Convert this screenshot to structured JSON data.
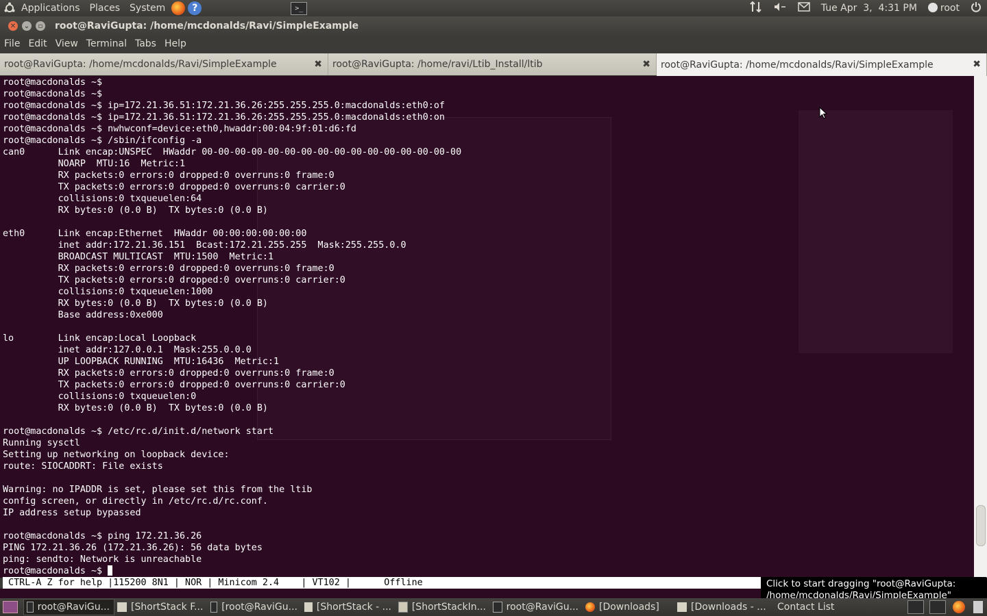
{
  "panel": {
    "applications": "Applications",
    "places": "Places",
    "system": "System",
    "help_glyph": "?",
    "datetime": "Tue Apr  3,  4:31 PM",
    "user": "root"
  },
  "window": {
    "title": "root@RaviGupta: /home/mcdonalds/Ravi/SimpleExample"
  },
  "menu": [
    "File",
    "Edit",
    "View",
    "Terminal",
    "Tabs",
    "Help"
  ],
  "tabs": [
    {
      "label": "root@RaviGupta: /home/mcdonalds/Ravi/SimpleExample"
    },
    {
      "label": "root@RaviGupta: /home/ravi/Ltib_Install/ltib"
    },
    {
      "label": "root@RaviGupta: /home/mcdonalds/Ravi/SimpleExample"
    }
  ],
  "tab_close_glyph": "✖",
  "terminal": {
    "lines": [
      "root@macdonalds ~$",
      "root@macdonalds ~$",
      "root@macdonalds ~$ ip=172.21.36.51:172.21.36.26:255.255.255.0:macdonalds:eth0:of",
      "root@macdonalds ~$ ip=172.21.36.51:172.21.36.26:255.255.255.0:macdonalds:eth0:on",
      "root@macdonalds ~$ nwhwconf=device:eth0,hwaddr:00:04:9f:01:d6:fd",
      "root@macdonalds ~$ /sbin/ifconfig -a",
      "can0      Link encap:UNSPEC  HWaddr 00-00-00-00-00-00-00-00-00-00-00-00-00-00-00-00",
      "          NOARP  MTU:16  Metric:1",
      "          RX packets:0 errors:0 dropped:0 overruns:0 frame:0",
      "          TX packets:0 errors:0 dropped:0 overruns:0 carrier:0",
      "          collisions:0 txqueuelen:64",
      "          RX bytes:0 (0.0 B)  TX bytes:0 (0.0 B)",
      "",
      "eth0      Link encap:Ethernet  HWaddr 00:00:00:00:00:00",
      "          inet addr:172.21.36.151  Bcast:172.21.255.255  Mask:255.255.0.0",
      "          BROADCAST MULTICAST  MTU:1500  Metric:1",
      "          RX packets:0 errors:0 dropped:0 overruns:0 frame:0",
      "          TX packets:0 errors:0 dropped:0 overruns:0 carrier:0",
      "          collisions:0 txqueuelen:1000",
      "          RX bytes:0 (0.0 B)  TX bytes:0 (0.0 B)",
      "          Base address:0xe000",
      "",
      "lo        Link encap:Local Loopback",
      "          inet addr:127.0.0.1  Mask:255.0.0.0",
      "          UP LOOPBACK RUNNING  MTU:16436  Metric:1",
      "          RX packets:0 errors:0 dropped:0 overruns:0 frame:0",
      "          TX packets:0 errors:0 dropped:0 overruns:0 carrier:0",
      "          collisions:0 txqueuelen:0",
      "          RX bytes:0 (0.0 B)  TX bytes:0 (0.0 B)",
      "",
      "root@macdonalds ~$ /etc/rc.d/init.d/network start",
      "Running sysctl",
      "Setting up networking on loopback device:",
      "route: SIOCADDRT: File exists",
      "",
      "Warning: no IPADDR is set, please set this from the ltib",
      "config screen, or directly in /etc/rc.d/rc.conf.",
      "IP address setup bypassed",
      "",
      "root@macdonalds ~$ ping 172.21.36.26",
      "PING 172.21.36.26 (172.21.36.26): 56 data bytes",
      "ping: sendto: Network is unreachable",
      "root@macdonalds ~$ "
    ]
  },
  "status_line": " CTRL-A Z for help |115200 8N1 | NOR | Minicom 2.4    | VT102 |      Offline",
  "tooltip": "Click to start dragging \"root@RaviGupta: /home/mcdonalds/Ravi/SimpleExample\"",
  "taskbar": {
    "items": [
      {
        "label": "root@RaviGu...",
        "icon": "terminal-icon",
        "active": true
      },
      {
        "label": "[ShortStack F...",
        "icon": "document-icon"
      },
      {
        "label": "[root@RaviGu...",
        "icon": "terminal-icon"
      },
      {
        "label": "[ShortStack - ...",
        "icon": "document-icon"
      },
      {
        "label": "[ShortStackIn...",
        "icon": "text-editor-icon"
      },
      {
        "label": "root@RaviGu...",
        "icon": "terminal-icon"
      },
      {
        "label": "[Downloads]",
        "icon": "firefox-icon"
      },
      {
        "label": "[Downloads - ...",
        "icon": "document-icon"
      },
      {
        "label": "Contact List",
        "icon": "chat-icon"
      }
    ]
  },
  "colors": {
    "terminal_bg": "#2c0a22",
    "terminal_fg": "#ffffff",
    "panel_bg": "#3c3b37",
    "tab_active_bg": "#f2f1ef"
  }
}
